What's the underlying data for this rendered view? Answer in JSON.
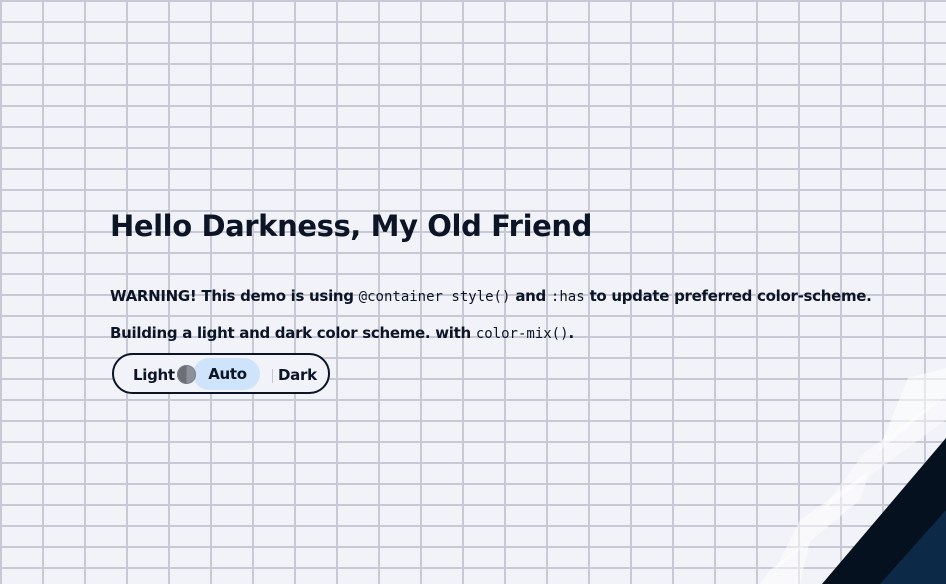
{
  "page": {
    "title": "Hello Darkness, My Old Friend"
  },
  "warning": {
    "prefix": "WARNING! This demo is using",
    "code1": "@container style()",
    "middle": "and",
    "code2": ":has",
    "suffix": "to update preferred color-scheme."
  },
  "info": {
    "prefix": "Building a light and dark color scheme. with",
    "code": "color-mix()",
    "suffix": "."
  },
  "scheme_toggle": {
    "options": [
      {
        "label": "Light",
        "selected": false
      },
      {
        "label": "Auto",
        "selected": true
      },
      {
        "label": "Dark",
        "selected": false
      }
    ],
    "selected": "Auto"
  },
  "colors": {
    "text": "#0b1526",
    "background": "#f2f3f9",
    "brick_line": "#c9c9d6",
    "auto_highlight": "#cfe4fb",
    "corner_dark": "#06111f",
    "corner_accent": "#0c2a47"
  },
  "icons": {
    "knob": "half-circle-theme-icon"
  }
}
